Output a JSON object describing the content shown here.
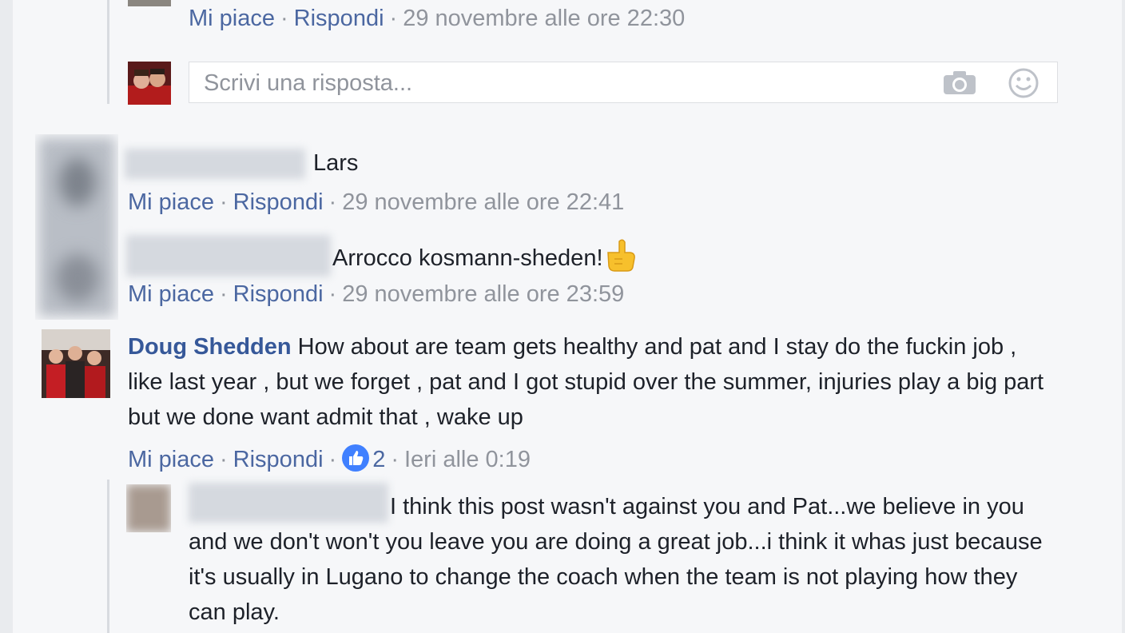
{
  "top_comment": {
    "like_label": "Mi piace",
    "reply_label": "Rispondi",
    "timestamp": "29 novembre alle ore 22:30"
  },
  "reply_box": {
    "placeholder": "Scrivi una risposta...",
    "camera_icon": "camera-icon",
    "emoji_icon": "smiley-icon"
  },
  "comments": [
    {
      "text": "Lars",
      "like_label": "Mi piace",
      "reply_label": "Rispondi",
      "timestamp": "29 novembre alle ore 22:41"
    },
    {
      "text": "Arrocco kosmann-sheden!",
      "emoji": "pointing-hand-emoji",
      "like_label": "Mi piace",
      "reply_label": "Rispondi",
      "timestamp": "29 novembre alle ore 23:59"
    },
    {
      "author": "Doug Shedden",
      "text": "How about are team gets healthy and pat and I stay do the fuckin job , like last year , but we forget , pat and I got stupid over the summer, injuries play a big part but we done want admit that , wake up",
      "like_label": "Mi piace",
      "reply_label": "Rispondi",
      "reaction_count": "2",
      "timestamp": "Ieri alle 0:19"
    }
  ],
  "nested_reply": {
    "text": "I think this post wasn't against you and Pat...we believe in you and we don't won't you leave you are doing a great job...i think it whas just because it's usually in Lugano to change the coach when the team is not playing how they can play."
  },
  "colors": {
    "link": "#4b67a1",
    "name": "#365899",
    "meta": "#90949c",
    "text": "#1d2129",
    "like_blue": "#4080ff"
  }
}
